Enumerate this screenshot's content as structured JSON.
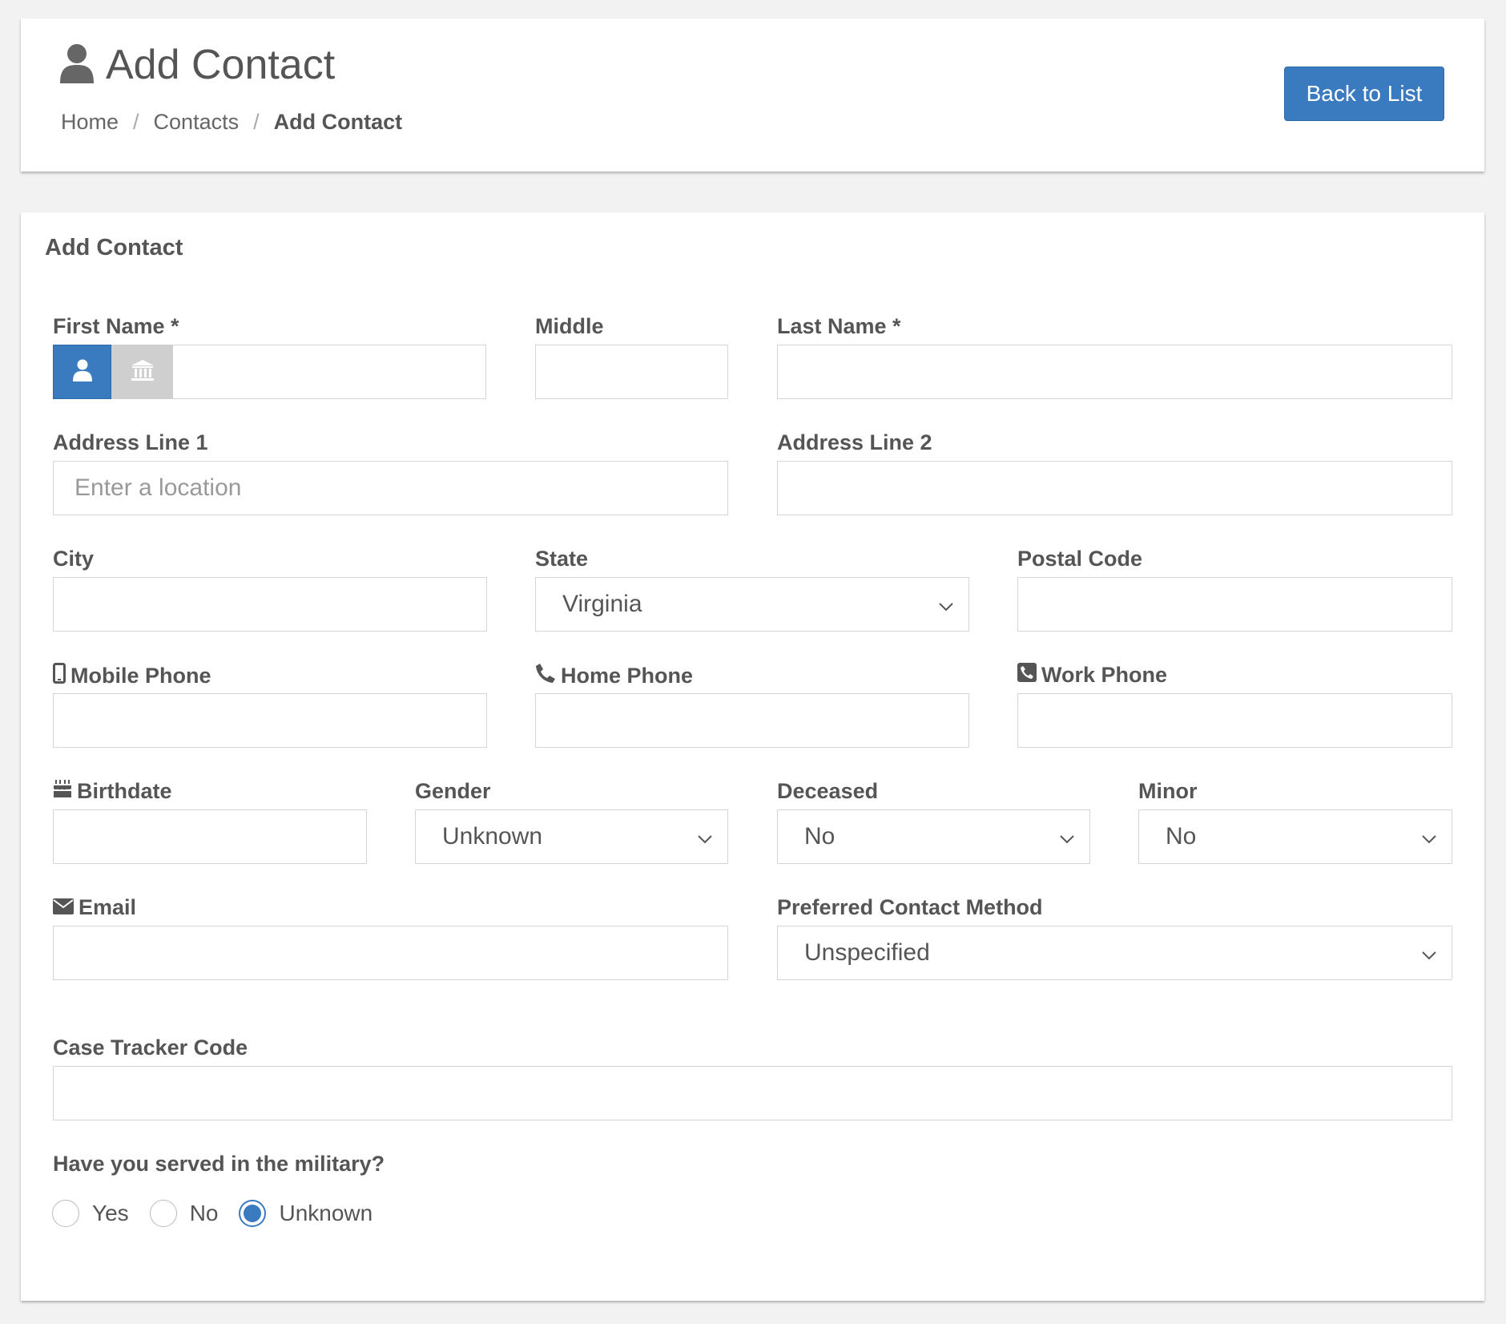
{
  "header": {
    "title": "Add Contact",
    "breadcrumb": [
      "Home",
      "Contacts",
      "Add Contact"
    ],
    "back_button": "Back to List"
  },
  "form": {
    "title": "Add Contact",
    "first_name_label": "First Name *",
    "middle_label": "Middle",
    "last_name_label": "Last Name *",
    "address1_label": "Address Line 1",
    "address1_placeholder": "Enter a location",
    "address2_label": "Address Line 2",
    "city_label": "City",
    "state_label": "State",
    "state_value": "Virginia",
    "postal_label": "Postal Code",
    "mobile_label": "Mobile Phone",
    "home_phone_label": "Home Phone",
    "work_phone_label": "Work Phone",
    "birthdate_label": "Birthdate",
    "gender_label": "Gender",
    "gender_value": "Unknown",
    "deceased_label": "Deceased",
    "deceased_value": "No",
    "minor_label": "Minor",
    "minor_value": "No",
    "email_label": "Email",
    "preferred_label": "Preferred Contact Method",
    "preferred_value": "Unspecified",
    "case_tracker_label": "Case Tracker Code",
    "military_label": "Have you served in the military?",
    "military_options": [
      "Yes",
      "No",
      "Unknown"
    ],
    "military_selected": "Unknown"
  },
  "colors": {
    "accent": "#3a7bc0",
    "background": "#f2f2f2",
    "panel": "#ffffff",
    "toggle_inactive": "#cfcfcf"
  },
  "icons": [
    "user-icon",
    "bank-icon",
    "mobile-icon",
    "phone-icon",
    "phone-square-icon",
    "cake-icon",
    "envelope-icon",
    "chevron-down-icon"
  ]
}
